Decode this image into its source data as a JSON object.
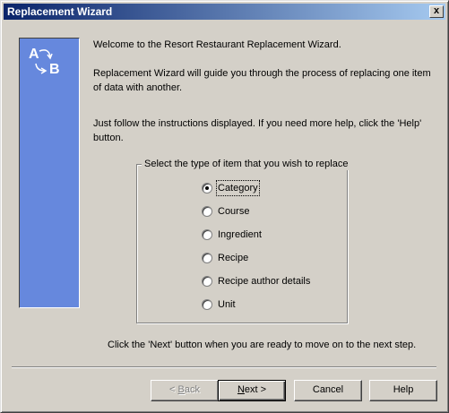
{
  "window": {
    "title": "Replacement Wizard",
    "close_glyph": "x"
  },
  "logo": {
    "letter_a": "A",
    "letter_b": "B"
  },
  "intro": {
    "welcome": "Welcome to the Resort Restaurant Replacement Wizard.",
    "description": "Replacement Wizard will guide you through the process of replacing one item of data with another.",
    "instructions": "Just follow the instructions displayed.  If you need more help, click the 'Help' button."
  },
  "group": {
    "legend": "Select the type of item that you wish to replace",
    "options": [
      {
        "label": "Category",
        "checked": true
      },
      {
        "label": "Course",
        "checked": false
      },
      {
        "label": "Ingredient",
        "checked": false
      },
      {
        "label": "Recipe",
        "checked": false
      },
      {
        "label": "Recipe author details",
        "checked": false
      },
      {
        "label": "Unit",
        "checked": false
      }
    ]
  },
  "footer_hint": "Click the 'Next' button when you are ready to move on to the next step.",
  "buttons": {
    "back": {
      "mnemonic": "B",
      "rest": "ack",
      "prefix": "< "
    },
    "next": {
      "mnemonic": "N",
      "rest": "ext >"
    },
    "cancel": "Cancel",
    "help": "Help"
  }
}
